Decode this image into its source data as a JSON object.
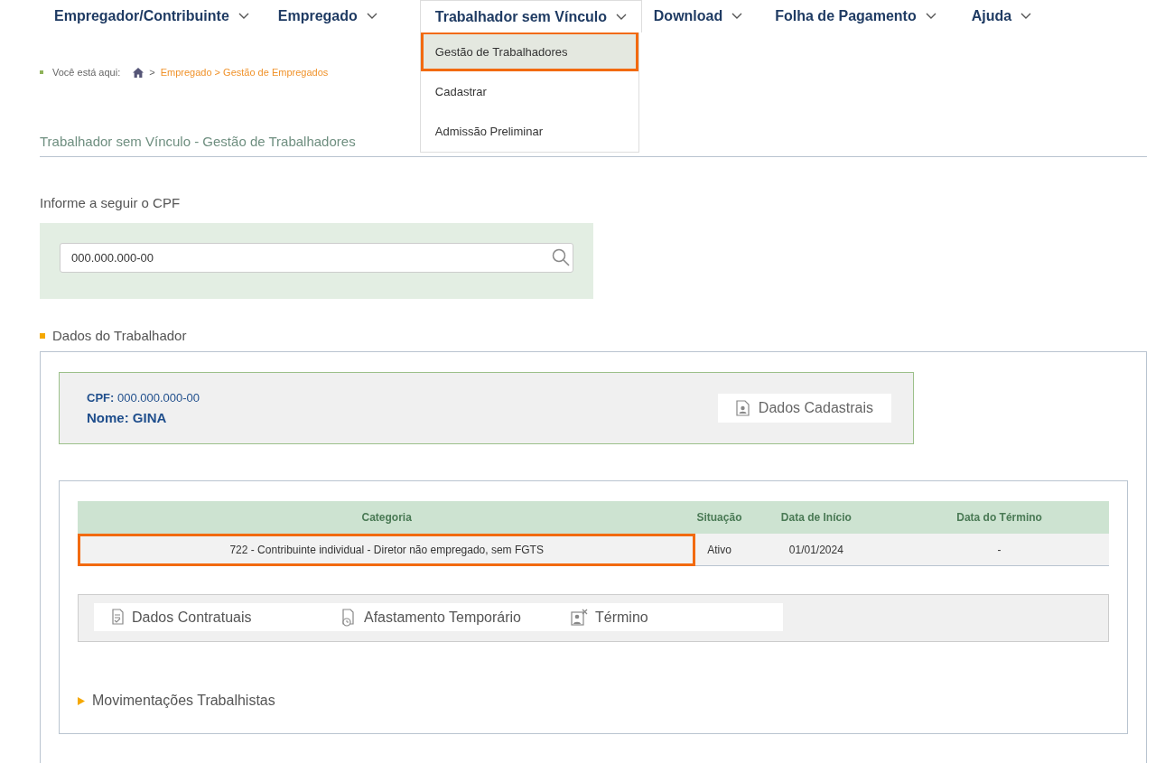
{
  "nav": [
    {
      "label": "Empregador/Contribuinte",
      "expanded": false
    },
    {
      "label": "Empregado",
      "expanded": false
    },
    {
      "label": "Trabalhador sem Vínculo",
      "expanded": true,
      "menu": [
        {
          "label": "Gestão de Trabalhadores",
          "selected": true
        },
        {
          "label": "Cadastrar",
          "selected": false
        },
        {
          "label": "Admissão Preliminar",
          "selected": false
        }
      ]
    },
    {
      "label": "Download",
      "expanded": false
    },
    {
      "label": "Folha de Pagamento",
      "expanded": false
    },
    {
      "label": "Ajuda",
      "expanded": false
    }
  ],
  "breadcrumb": {
    "prefix": "Você está aqui:",
    "separator": ">",
    "path": "Empregado > Gestão de Empregados"
  },
  "page_title": "Trabalhador sem Vínculo - Gestão de Trabalhadores",
  "cpf_prompt": "Informe a seguir o CPF",
  "cpf_field": {
    "value": "000.000.000-00"
  },
  "section_title": "Dados do Trabalhador",
  "worker": {
    "cpf_label": "CPF:",
    "cpf": "000.000.000-00",
    "name_label": "Nome:",
    "name": "GINA",
    "button": "Dados Cadastrais"
  },
  "table": {
    "columns": [
      "Categoria",
      "Situação",
      "Data de Início",
      "Data do Término"
    ],
    "rows": [
      {
        "cells": [
          "722 - Contribuinte individual - Diretor não empregado, sem FGTS",
          "Ativo",
          "01/01/2024",
          "-"
        ],
        "highlighted": true
      }
    ]
  },
  "actions": [
    {
      "label": "Dados Contratuais",
      "kind": "contract"
    },
    {
      "label": "Afastamento Temporário",
      "kind": "leave"
    },
    {
      "label": "Término",
      "kind": "end"
    }
  ],
  "movements": {
    "label": "Movimentações Trabalhistas",
    "expanded": false
  }
}
